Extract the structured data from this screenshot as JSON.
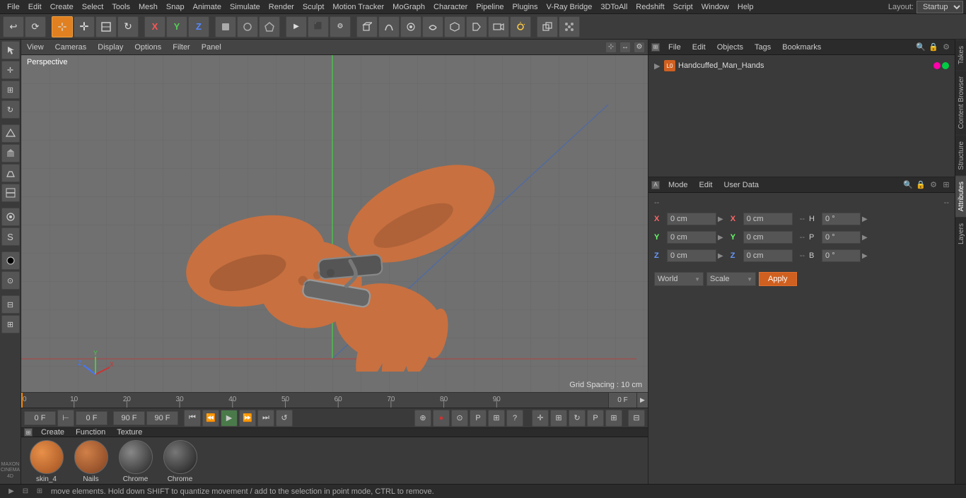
{
  "app": {
    "title": "Cinema 4D"
  },
  "menus": {
    "items": [
      "File",
      "Edit",
      "Create",
      "Select",
      "Tools",
      "Mesh",
      "Snap",
      "Animate",
      "Simulate",
      "Render",
      "Sculpt",
      "Motion Tracker",
      "MoGraph",
      "Character",
      "Pipeline",
      "Plugins",
      "V-Ray Bridge",
      "3DToAll",
      "Redshift",
      "Script",
      "Window",
      "Help"
    ],
    "layout_label": "Layout:",
    "layout_value": "Startup"
  },
  "toolbar": {
    "undo_label": "↩",
    "redo_label": "⟳",
    "move_label": "✛",
    "scale_label": "⊞",
    "rotate_label": "↻",
    "x_label": "X",
    "y_label": "Y",
    "z_label": "Z"
  },
  "viewport": {
    "header_items": [
      "View",
      "Cameras",
      "Display",
      "Options",
      "Filter",
      "Panel"
    ],
    "perspective": "Perspective",
    "grid_spacing": "Grid Spacing : 10 cm"
  },
  "timeline": {
    "ticks": [
      0,
      10,
      20,
      30,
      40,
      50,
      60,
      70,
      80,
      90
    ],
    "current_frame": "0 F",
    "end_frame": "90 F",
    "start_frame": "0 F"
  },
  "playback": {
    "start_frame": "0 F",
    "current_frame": "0 F",
    "end_frame": "90 F",
    "end_frame2": "90 F"
  },
  "objects_panel": {
    "header_items": [
      "File",
      "Edit",
      "Objects",
      "Tags",
      "Bookmarks"
    ],
    "object_name": "Handcuffed_Man_Hands",
    "object_icon": "L0"
  },
  "attributes_panel": {
    "header_items": [
      "Mode",
      "Edit",
      "User Data"
    ],
    "rows": [
      {
        "label": "X",
        "val1": "0 cm",
        "arrow": ">",
        "label2": "X",
        "val2": "0 cm",
        "dash": "--",
        "label3": "H",
        "val3": "0 °",
        "arrow2": ">"
      },
      {
        "label": "Y",
        "val1": "0 cm",
        "arrow": ">",
        "label2": "Y",
        "val2": "0 cm",
        "dash": "--",
        "label3": "P",
        "val3": "0 °",
        "arrow2": ">"
      },
      {
        "label": "Z",
        "val1": "0 cm",
        "arrow": ">",
        "label2": "Z",
        "val2": "0 cm",
        "dash": "--",
        "label3": "B",
        "val3": "0 °",
        "arrow2": ">"
      }
    ],
    "dropdown": {
      "world_label": "World",
      "scale_label": "Scale",
      "apply_label": "Apply"
    }
  },
  "materials": {
    "header_items": [
      "Create",
      "Function",
      "Texture"
    ],
    "items": [
      {
        "name": "skin_4",
        "color": "#c87040"
      },
      {
        "name": "Nails",
        "color": "#b06030"
      },
      {
        "name": "Chrome",
        "color": "#222222"
      },
      {
        "name": "Chrome",
        "color": "#333333"
      }
    ]
  },
  "right_tabs": [
    "Takes",
    "Content Browser",
    "Structure",
    "Attributes",
    "Layers"
  ],
  "status_bar": {
    "text": "move elements. Hold down SHIFT to quantize movement / add to the selection in point mode, CTRL to remove."
  },
  "left_tools": [
    "cursor",
    "move",
    "scale",
    "rotate",
    "object",
    "extrude",
    "bevel",
    "loop",
    "brush",
    "paint",
    "material",
    "select",
    "box",
    "sphere",
    "cylinder",
    "spline",
    "bend",
    "light"
  ]
}
